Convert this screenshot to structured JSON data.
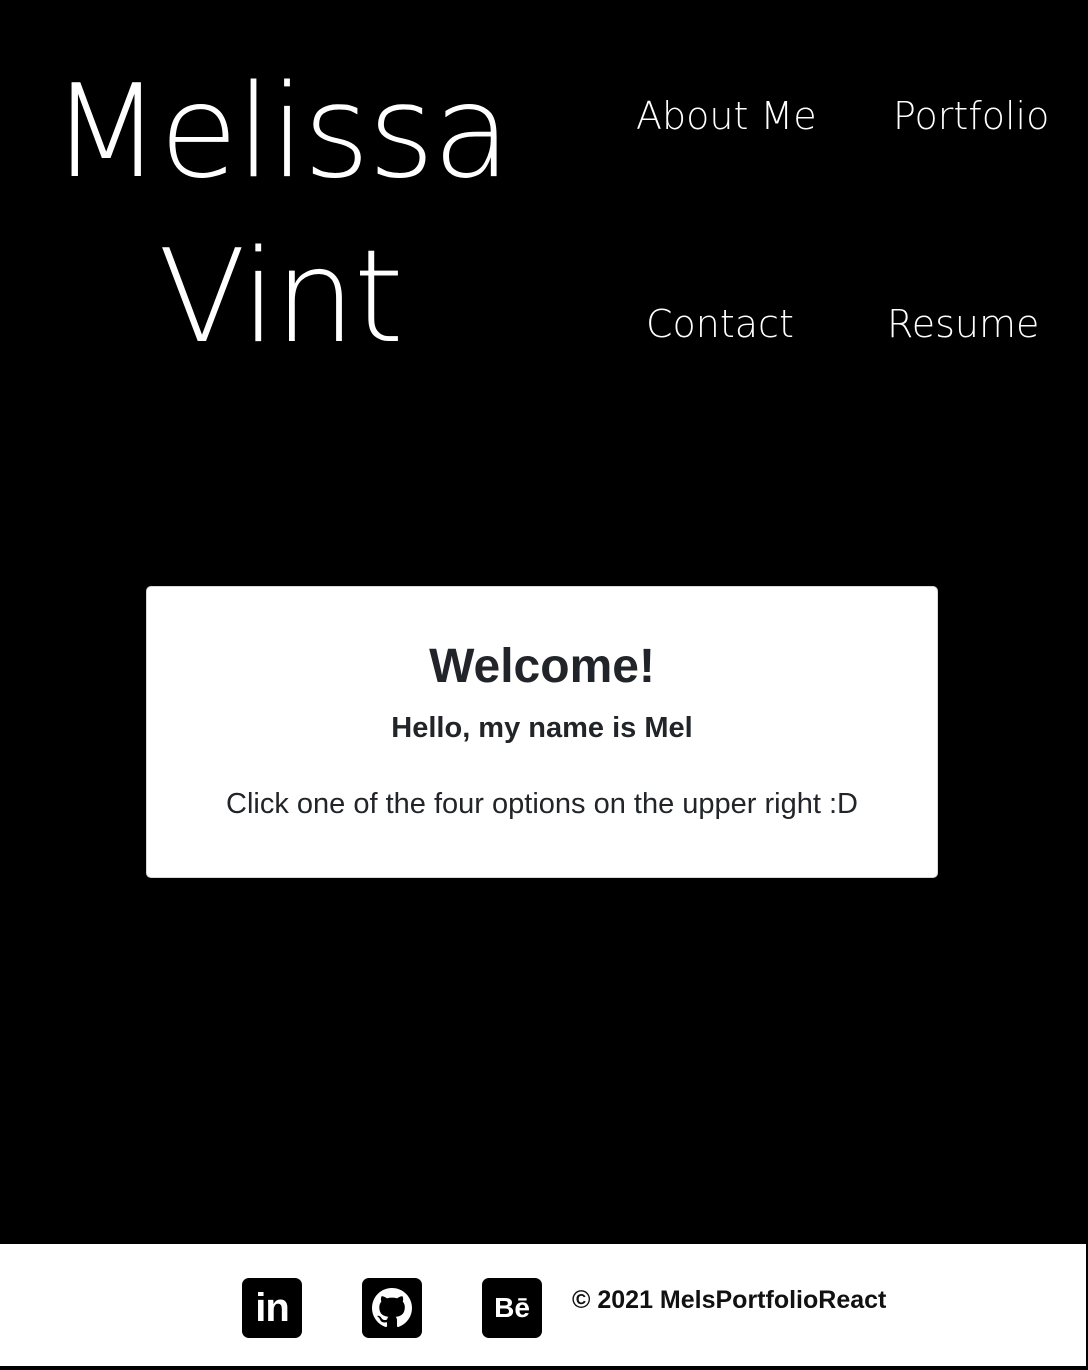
{
  "header": {
    "name_line1": "Melissa",
    "name_line2": "Vint"
  },
  "nav": {
    "about": "About Me",
    "portfolio": "Portfolio",
    "contact": "Contact",
    "resume": "Resume"
  },
  "welcome_card": {
    "title": "Welcome!",
    "subtitle": "Hello, my name is Mel",
    "body": "Click one of the four options on the upper right :D"
  },
  "footer": {
    "social": [
      {
        "icon": "linkedin-icon",
        "text": "in"
      },
      {
        "icon": "github-icon"
      },
      {
        "icon": "behance-icon",
        "text": "Bē"
      }
    ],
    "copyright": "© 2021 MelsPortfolioReact"
  },
  "colors": {
    "page_background": "#000000",
    "card_background": "#ffffff",
    "text_dark": "#212529"
  }
}
